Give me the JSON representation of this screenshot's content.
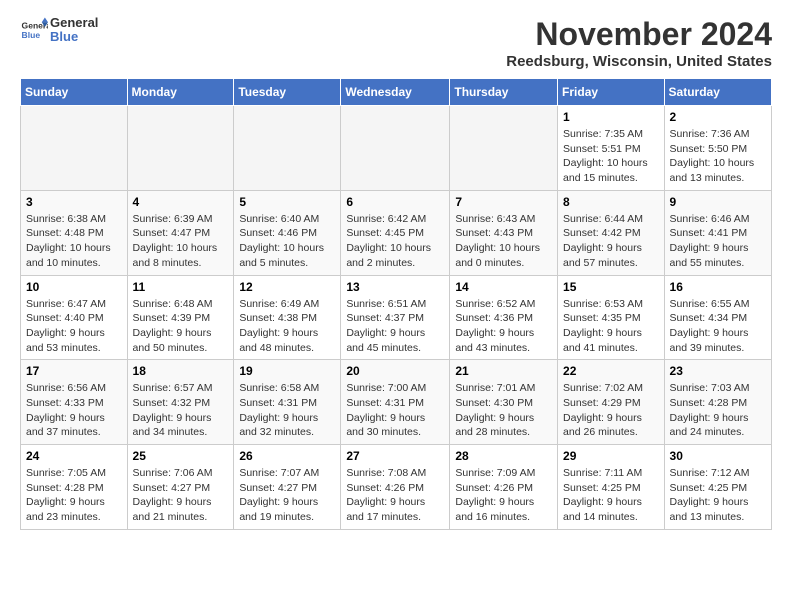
{
  "header": {
    "logo_line1": "General",
    "logo_line2": "Blue",
    "month": "November 2024",
    "location": "Reedsburg, Wisconsin, United States"
  },
  "weekdays": [
    "Sunday",
    "Monday",
    "Tuesday",
    "Wednesday",
    "Thursday",
    "Friday",
    "Saturday"
  ],
  "weeks": [
    [
      {
        "day": "",
        "info": ""
      },
      {
        "day": "",
        "info": ""
      },
      {
        "day": "",
        "info": ""
      },
      {
        "day": "",
        "info": ""
      },
      {
        "day": "",
        "info": ""
      },
      {
        "day": "1",
        "info": "Sunrise: 7:35 AM\nSunset: 5:51 PM\nDaylight: 10 hours and 15 minutes."
      },
      {
        "day": "2",
        "info": "Sunrise: 7:36 AM\nSunset: 5:50 PM\nDaylight: 10 hours and 13 minutes."
      }
    ],
    [
      {
        "day": "3",
        "info": "Sunrise: 6:38 AM\nSunset: 4:48 PM\nDaylight: 10 hours and 10 minutes."
      },
      {
        "day": "4",
        "info": "Sunrise: 6:39 AM\nSunset: 4:47 PM\nDaylight: 10 hours and 8 minutes."
      },
      {
        "day": "5",
        "info": "Sunrise: 6:40 AM\nSunset: 4:46 PM\nDaylight: 10 hours and 5 minutes."
      },
      {
        "day": "6",
        "info": "Sunrise: 6:42 AM\nSunset: 4:45 PM\nDaylight: 10 hours and 2 minutes."
      },
      {
        "day": "7",
        "info": "Sunrise: 6:43 AM\nSunset: 4:43 PM\nDaylight: 10 hours and 0 minutes."
      },
      {
        "day": "8",
        "info": "Sunrise: 6:44 AM\nSunset: 4:42 PM\nDaylight: 9 hours and 57 minutes."
      },
      {
        "day": "9",
        "info": "Sunrise: 6:46 AM\nSunset: 4:41 PM\nDaylight: 9 hours and 55 minutes."
      }
    ],
    [
      {
        "day": "10",
        "info": "Sunrise: 6:47 AM\nSunset: 4:40 PM\nDaylight: 9 hours and 53 minutes."
      },
      {
        "day": "11",
        "info": "Sunrise: 6:48 AM\nSunset: 4:39 PM\nDaylight: 9 hours and 50 minutes."
      },
      {
        "day": "12",
        "info": "Sunrise: 6:49 AM\nSunset: 4:38 PM\nDaylight: 9 hours and 48 minutes."
      },
      {
        "day": "13",
        "info": "Sunrise: 6:51 AM\nSunset: 4:37 PM\nDaylight: 9 hours and 45 minutes."
      },
      {
        "day": "14",
        "info": "Sunrise: 6:52 AM\nSunset: 4:36 PM\nDaylight: 9 hours and 43 minutes."
      },
      {
        "day": "15",
        "info": "Sunrise: 6:53 AM\nSunset: 4:35 PM\nDaylight: 9 hours and 41 minutes."
      },
      {
        "day": "16",
        "info": "Sunrise: 6:55 AM\nSunset: 4:34 PM\nDaylight: 9 hours and 39 minutes."
      }
    ],
    [
      {
        "day": "17",
        "info": "Sunrise: 6:56 AM\nSunset: 4:33 PM\nDaylight: 9 hours and 37 minutes."
      },
      {
        "day": "18",
        "info": "Sunrise: 6:57 AM\nSunset: 4:32 PM\nDaylight: 9 hours and 34 minutes."
      },
      {
        "day": "19",
        "info": "Sunrise: 6:58 AM\nSunset: 4:31 PM\nDaylight: 9 hours and 32 minutes."
      },
      {
        "day": "20",
        "info": "Sunrise: 7:00 AM\nSunset: 4:31 PM\nDaylight: 9 hours and 30 minutes."
      },
      {
        "day": "21",
        "info": "Sunrise: 7:01 AM\nSunset: 4:30 PM\nDaylight: 9 hours and 28 minutes."
      },
      {
        "day": "22",
        "info": "Sunrise: 7:02 AM\nSunset: 4:29 PM\nDaylight: 9 hours and 26 minutes."
      },
      {
        "day": "23",
        "info": "Sunrise: 7:03 AM\nSunset: 4:28 PM\nDaylight: 9 hours and 24 minutes."
      }
    ],
    [
      {
        "day": "24",
        "info": "Sunrise: 7:05 AM\nSunset: 4:28 PM\nDaylight: 9 hours and 23 minutes."
      },
      {
        "day": "25",
        "info": "Sunrise: 7:06 AM\nSunset: 4:27 PM\nDaylight: 9 hours and 21 minutes."
      },
      {
        "day": "26",
        "info": "Sunrise: 7:07 AM\nSunset: 4:27 PM\nDaylight: 9 hours and 19 minutes."
      },
      {
        "day": "27",
        "info": "Sunrise: 7:08 AM\nSunset: 4:26 PM\nDaylight: 9 hours and 17 minutes."
      },
      {
        "day": "28",
        "info": "Sunrise: 7:09 AM\nSunset: 4:26 PM\nDaylight: 9 hours and 16 minutes."
      },
      {
        "day": "29",
        "info": "Sunrise: 7:11 AM\nSunset: 4:25 PM\nDaylight: 9 hours and 14 minutes."
      },
      {
        "day": "30",
        "info": "Sunrise: 7:12 AM\nSunset: 4:25 PM\nDaylight: 9 hours and 13 minutes."
      }
    ]
  ]
}
